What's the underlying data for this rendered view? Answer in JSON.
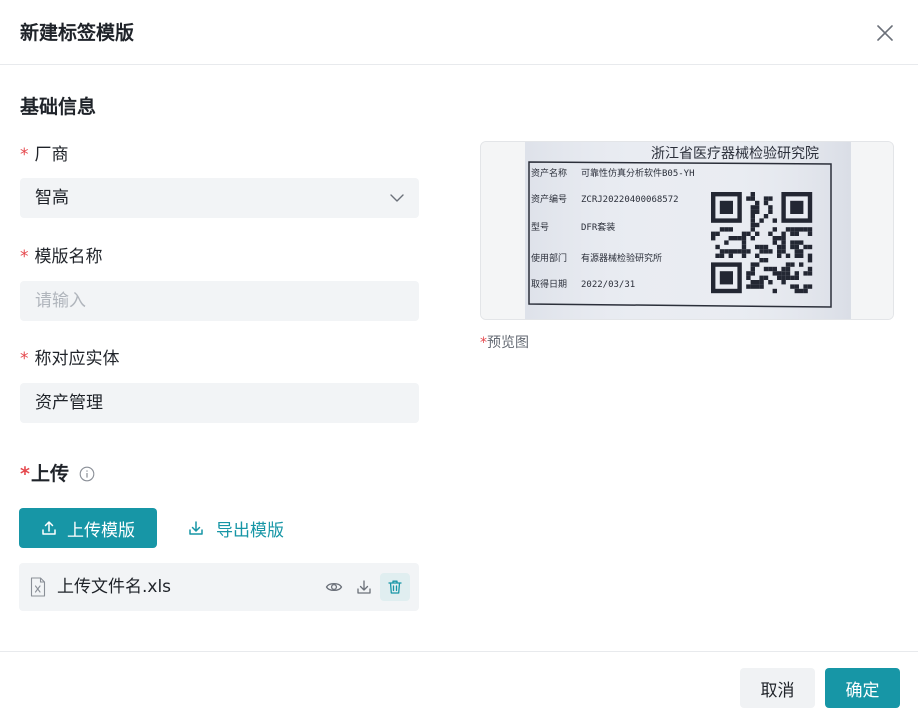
{
  "dialog": {
    "title": "新建标签模版",
    "close_icon": "close-icon"
  },
  "basic_info": {
    "title": "基础信息",
    "required_mark": "*",
    "vendor": {
      "label": "厂商",
      "value": "智高"
    },
    "template_name": {
      "label": "模版名称",
      "value": "",
      "placeholder": "请输入"
    },
    "entity": {
      "label": "称对应实体",
      "value": "资产管理"
    }
  },
  "upload": {
    "label": "上传",
    "info_icon": "info-circle-icon",
    "upload_button": "上传模版",
    "export_link": "导出模版",
    "file": {
      "name": "上传文件名.xls",
      "actions": [
        "eye-icon",
        "download-icon",
        "trash-icon"
      ]
    }
  },
  "preview": {
    "label": "预览图",
    "label_box": {
      "org": "浙江省医疗器械检验研究院",
      "rows": [
        {
          "key": "资产名称",
          "value": "可靠性仿真分析软件B05-YH"
        },
        {
          "key": "资产编号",
          "value": "ZCRJ20220400068572"
        },
        {
          "key": "型号",
          "value": "DFR套装"
        },
        {
          "key": "使用部门",
          "value": "有源器械检验研究所"
        },
        {
          "key": "取得日期",
          "value": "2022/03/31"
        }
      ]
    }
  },
  "footer": {
    "cancel": "取消",
    "confirm": "确定"
  },
  "colors": {
    "primary": "#1796a6",
    "required": "#e5484d",
    "field_bg": "#f2f4f6"
  }
}
